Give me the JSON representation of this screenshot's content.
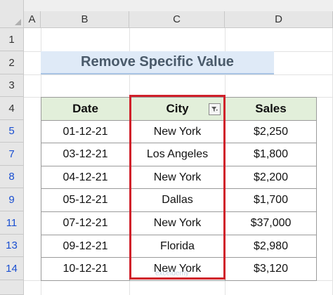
{
  "columns": [
    "A",
    "B",
    "C",
    "D"
  ],
  "rows": [
    "1",
    "2",
    "3",
    "4",
    "5",
    "7",
    "8",
    "9",
    "11",
    "13",
    "14"
  ],
  "title": "Remove Specific Value",
  "table": {
    "headers": [
      "Date",
      "City",
      "Sales"
    ],
    "data": [
      [
        "01-12-21",
        "New York",
        "$2,250"
      ],
      [
        "03-12-21",
        "Los Angeles",
        "$1,800"
      ],
      [
        "04-12-21",
        "New York",
        "$2,200"
      ],
      [
        "05-12-21",
        "Dallas",
        "$1,700"
      ],
      [
        "07-12-21",
        "New York",
        "$37,000"
      ],
      [
        "09-12-21",
        "Florida",
        "$2,980"
      ],
      [
        "10-12-21",
        "New York",
        "$3,120"
      ]
    ]
  },
  "filter_icon": "filter-funnel-icon",
  "highlight_color": "#d0202a",
  "header_fill": "#e2efda",
  "title_fill": "#dfeaf7",
  "watermark": "exceldemy"
}
